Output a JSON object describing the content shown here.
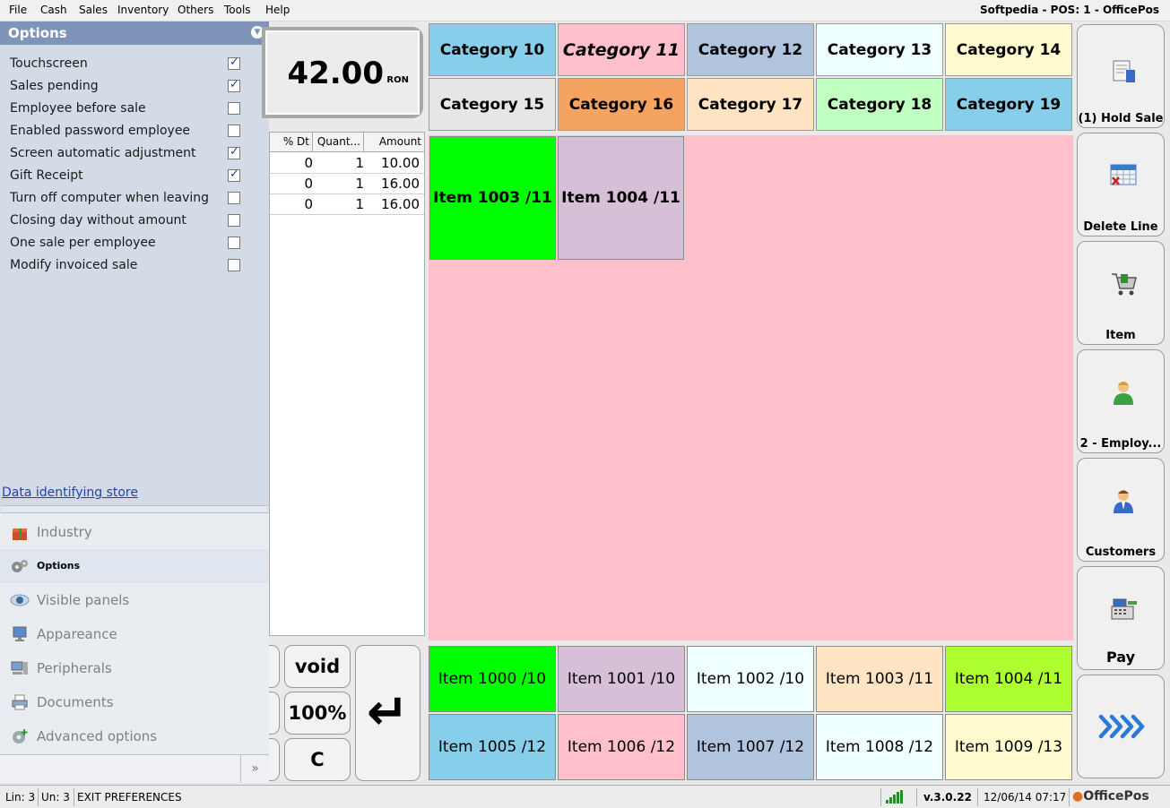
{
  "menubar": {
    "items": [
      "File",
      "Cash",
      "Sales",
      "Inventory",
      "Others",
      "Tools",
      "Help"
    ],
    "title": "Softpedia - POS: 1 - OfficePos"
  },
  "options_panel": {
    "title": "Options",
    "options": [
      {
        "label": "Touchscreen",
        "checked": true
      },
      {
        "label": "Sales pending",
        "checked": true
      },
      {
        "label": "Employee before sale",
        "checked": false
      },
      {
        "label": "Enabled password employee",
        "checked": false
      },
      {
        "label": "Screen automatic adjustment",
        "checked": true
      },
      {
        "label": "Gift Receipt",
        "checked": true
      },
      {
        "label": "Turn off computer when leaving",
        "checked": false
      },
      {
        "label": "Closing day without amount",
        "checked": false
      },
      {
        "label": "One sale per employee",
        "checked": false
      },
      {
        "label": "Modify invoiced sale",
        "checked": false
      }
    ],
    "data_link": "Data identifying store",
    "nav": [
      {
        "label": "Industry",
        "icon": "gift-icon",
        "active": false
      },
      {
        "label": "Options",
        "icon": "gears-icon",
        "active": true
      },
      {
        "label": "Visible panels",
        "icon": "eye-icon",
        "active": false
      },
      {
        "label": "Appareance",
        "icon": "monitor-icon",
        "active": false
      },
      {
        "label": "Peripherals",
        "icon": "computer-icon",
        "active": false
      },
      {
        "label": "Documents",
        "icon": "printer-icon",
        "active": false
      },
      {
        "label": "Advanced options",
        "icon": "gear-plus-icon",
        "active": false
      }
    ],
    "more": "»"
  },
  "display": {
    "value": "42.00",
    "currency": "RON"
  },
  "sale_grid": {
    "headers": [
      "% Dt",
      "Quant...",
      "Amount"
    ],
    "rows": [
      [
        "0",
        "1",
        "10.00"
      ],
      [
        "0",
        "1",
        "16.00"
      ],
      [
        "0",
        "1",
        "16.00"
      ]
    ]
  },
  "keypad": {
    "void": "void",
    "percent": "100%",
    "clear": "C",
    "enter": "↵"
  },
  "categories": [
    {
      "label": "Category 10",
      "color": "#87ceeb",
      "italic": false
    },
    {
      "label": "Category 11",
      "color": "#ffc0cb",
      "italic": true
    },
    {
      "label": "Category 12",
      "color": "#b0c4de",
      "italic": false
    },
    {
      "label": "Category 13",
      "color": "#f0ffff",
      "italic": false
    },
    {
      "label": "Category 14",
      "color": "#fffacd",
      "italic": false
    },
    {
      "label": "Category 15",
      "color": "#e6e6e6",
      "italic": false
    },
    {
      "label": "Category 16",
      "color": "#f4a460",
      "italic": false
    },
    {
      "label": "Category 17",
      "color": "#ffe4c4",
      "italic": false
    },
    {
      "label": "Category 18",
      "color": "#c1ffc1",
      "italic": false
    },
    {
      "label": "Category 19",
      "color": "#87ceeb",
      "italic": false
    }
  ],
  "category_items": [
    {
      "label": "Item 1003 /11",
      "color": "#00ff00"
    },
    {
      "label": "Item 1004 /11",
      "color": "#d8bfd8"
    }
  ],
  "quick_items": [
    {
      "label": "Item 1000 /10",
      "color": "#00ff00"
    },
    {
      "label": "Item 1001 /10",
      "color": "#d8bfd8"
    },
    {
      "label": "Item 1002 /10",
      "color": "#f0ffff"
    },
    {
      "label": "Item 1003 /11",
      "color": "#ffe4c4"
    },
    {
      "label": "Item 1004 /11",
      "color": "#adff2f"
    },
    {
      "label": "Item 1005 /12",
      "color": "#87ceeb"
    },
    {
      "label": "Item 1006 /12",
      "color": "#ffc0cb"
    },
    {
      "label": "Item 1007 /12",
      "color": "#b0c4de"
    },
    {
      "label": "Item 1008 /12",
      "color": "#f0ffff"
    },
    {
      "label": "Item 1009 /13",
      "color": "#fffacd"
    }
  ],
  "side_buttons": [
    {
      "label": "(1) Hold Sale",
      "icon": "receipt-icon"
    },
    {
      "label": "Delete Line",
      "icon": "calendar-delete-icon"
    },
    {
      "label": "Item",
      "icon": "cart-icon"
    },
    {
      "label": "2 - Employ...",
      "icon": "employee-icon"
    },
    {
      "label": "Customers",
      "icon": "customer-icon"
    },
    {
      "label": "Pay",
      "icon": "cash-register-icon"
    },
    {
      "label": "",
      "icon": "forward-arrows-icon"
    }
  ],
  "statusbar": {
    "lin": "Lin: 3",
    "un": "Un: 3",
    "message": "EXIT PREFERENCES",
    "version": "v.3.0.22",
    "datetime": "12/06/14 07:17",
    "logo": "OfficePos"
  }
}
